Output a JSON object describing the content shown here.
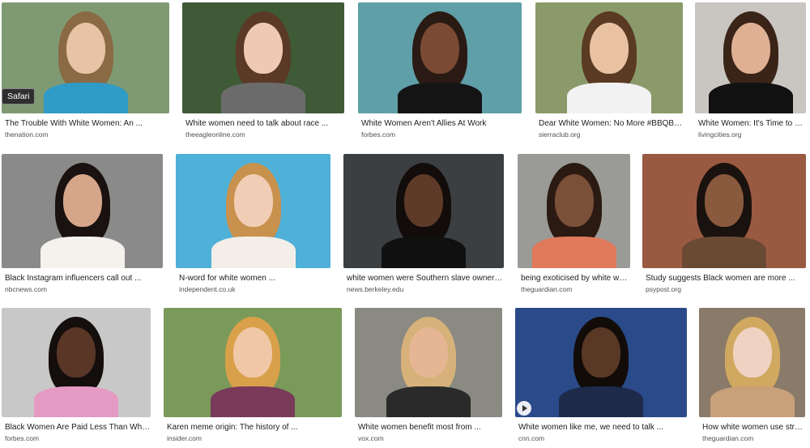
{
  "tooltip": "Safari",
  "results": [
    {
      "title": "The Trouble With White Women: An ...",
      "source": "thenation.com"
    },
    {
      "title": "White women need to talk about race ...",
      "source": "theeagleonline.com"
    },
    {
      "title": "White Women Aren't Allies At Work",
      "source": "forbes.com"
    },
    {
      "title": "Dear White Women: No More #BBQBeck...",
      "source": "sierraclub.org"
    },
    {
      "title": "White Women: It's Time to Re...",
      "source": "livingcities.org"
    },
    {
      "title": "Black Instagram influencers call out ...",
      "source": "nbcnews.com"
    },
    {
      "title": "N-word for white women ...",
      "source": "independent.co.uk"
    },
    {
      "title": "white women were Southern slave owners ...",
      "source": "news.berkeley.edu"
    },
    {
      "title": "being exoticised by white wo...",
      "source": "theguardian.com"
    },
    {
      "title": "Study suggests Black women are more ...",
      "source": "psypost.org"
    },
    {
      "title": "Black Women Are Paid Less Than White ...",
      "source": "forbes.com"
    },
    {
      "title": "Karen meme origin: The history of ...",
      "source": "insider.com"
    },
    {
      "title": "White women benefit most from ...",
      "source": "vox.com"
    },
    {
      "title": "White women like me, we need to talk ...",
      "source": "cnn.com"
    },
    {
      "title": "How white women use strat...",
      "source": "theguardian.com"
    }
  ],
  "colors": {
    "title": "#202124",
    "source": "#4d5156",
    "background": "#ffffff"
  }
}
